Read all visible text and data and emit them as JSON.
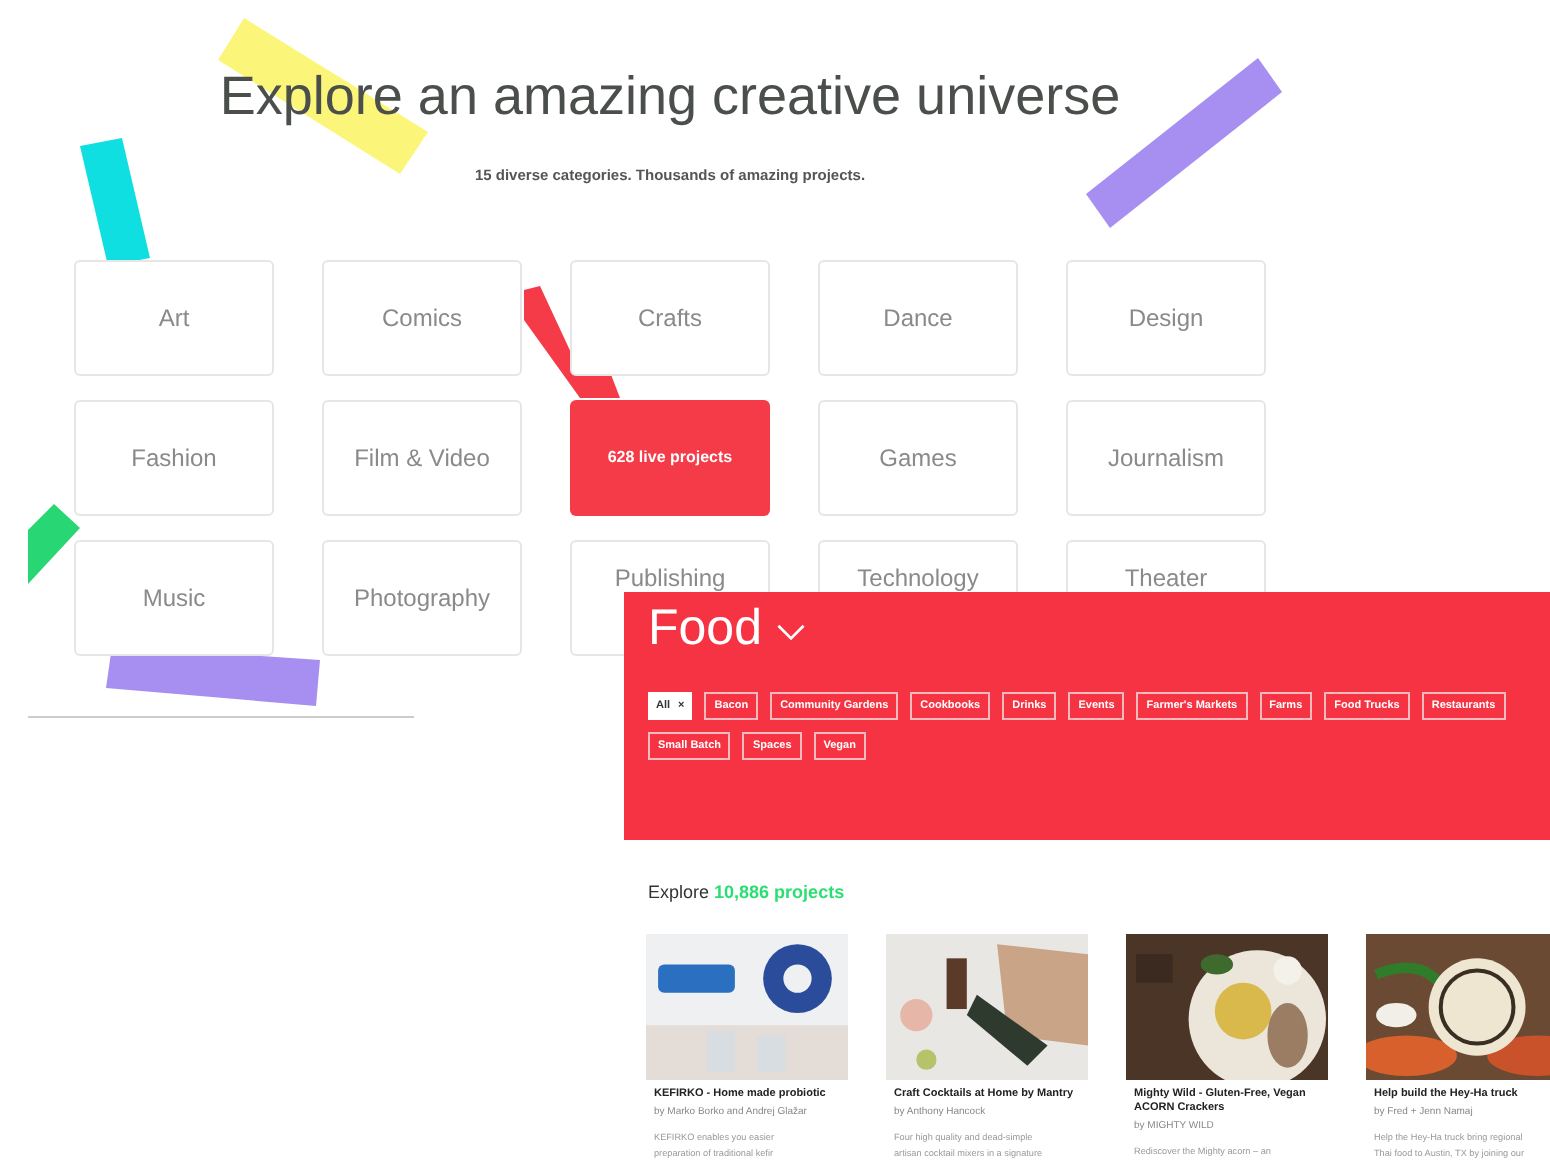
{
  "hero": {
    "title": "Explore an amazing creative universe",
    "subtitle": "15 diverse categories. Thousands of amazing projects."
  },
  "categories": [
    {
      "label": "Art",
      "selected": false
    },
    {
      "label": "Comics",
      "selected": false
    },
    {
      "label": "Crafts",
      "selected": false
    },
    {
      "label": "Dance",
      "selected": false
    },
    {
      "label": "Design",
      "selected": false
    },
    {
      "label": "Fashion",
      "selected": false
    },
    {
      "label": "Film & Video",
      "selected": false
    },
    {
      "label": "628 live projects",
      "selected": true
    },
    {
      "label": "Games",
      "selected": false
    },
    {
      "label": "Journalism",
      "selected": false
    },
    {
      "label": "Music",
      "selected": false
    },
    {
      "label": "Photography",
      "selected": false
    },
    {
      "label": "Publishing",
      "selected": false
    },
    {
      "label": "Technology",
      "selected": false
    },
    {
      "label": "Theater",
      "selected": false
    }
  ],
  "category_page": {
    "title": "Food",
    "tags": [
      {
        "label": "All",
        "selected": true,
        "removable": true
      },
      {
        "label": "Bacon",
        "selected": false
      },
      {
        "label": "Community Gardens",
        "selected": false
      },
      {
        "label": "Cookbooks",
        "selected": false
      },
      {
        "label": "Drinks",
        "selected": false
      },
      {
        "label": "Events",
        "selected": false
      },
      {
        "label": "Farmer's Markets",
        "selected": false
      },
      {
        "label": "Farms",
        "selected": false
      },
      {
        "label": "Food Trucks",
        "selected": false
      },
      {
        "label": "Restaurants",
        "selected": false
      },
      {
        "label": "Small Batch",
        "selected": false
      },
      {
        "label": "Spaces",
        "selected": false
      },
      {
        "label": "Vegan",
        "selected": false
      }
    ],
    "remove_mark": "×",
    "explore_prefix": "Explore",
    "explore_count": "10,886 projects",
    "projects": [
      {
        "title": "KEFIRKO - Home made probiotic",
        "byline": "by Marko Borko and Andrej Glažar",
        "description": [
          "KEFIRKO enables you easier",
          "preparation of traditional kefir"
        ]
      },
      {
        "title": "Craft Cocktails at Home by Mantry",
        "byline": "by Anthony Hancock",
        "description": [
          "Four high quality and dead-simple",
          "artisan cocktail mixers in a signature"
        ]
      },
      {
        "title": "Mighty Wild - Gluten-Free, Vegan ACORN Crackers",
        "byline": "by MIGHTY WILD",
        "description": [
          "Rediscover the Mighty acorn – an"
        ]
      },
      {
        "title": "Help build the Hey-Ha truck",
        "byline": "by Fred + Jenn Namaj",
        "description": [
          "Help the Hey-Ha truck bring regional",
          "Thai food to Austin, TX by joining our"
        ]
      }
    ]
  }
}
